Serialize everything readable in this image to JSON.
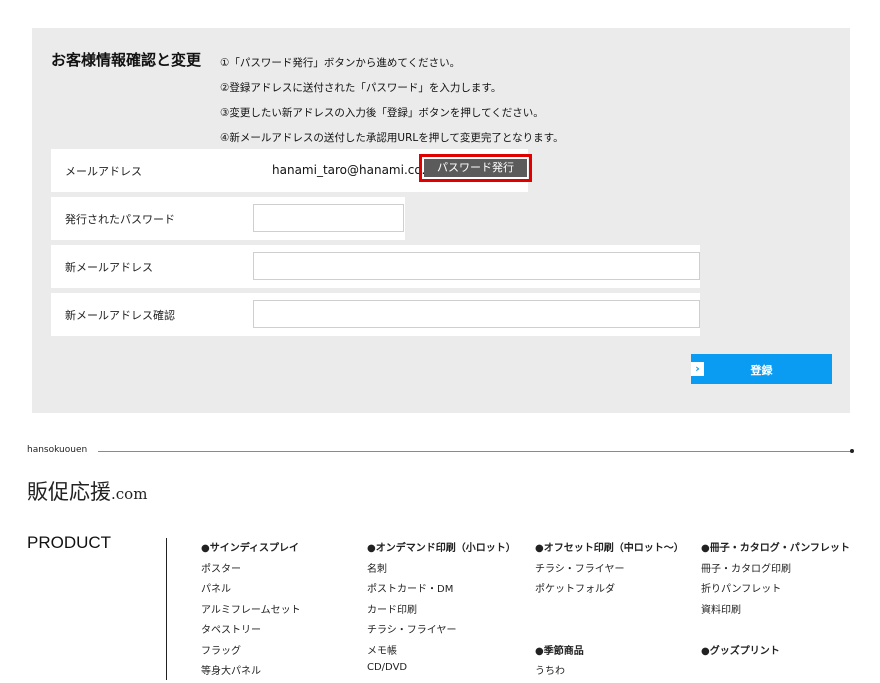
{
  "form": {
    "title": "お客様情報確認と変更",
    "instructions": [
      "①「パスワード発行」ボタンから進めてください。",
      "②登録アドレスに送付された「パスワード」を入力します。",
      "③変更したい新アドレスの入力後「登録」ボタンを押してください。",
      "④新メールアドレスの送付した承認用URLを押して変更完了となります。"
    ],
    "email_label": "メールアドレス",
    "email_value": "hanami_taro@hanami.co.jp",
    "issue_password_button": "パスワード発行",
    "issued_password_label": "発行されたパスワード",
    "issued_password_value": "",
    "new_email_label": "新メールアドレス",
    "new_email_value": "",
    "new_email_confirm_label": "新メールアドレス確認",
    "new_email_confirm_value": "",
    "submit_button": "登録",
    "highlight_color": "#e00000",
    "submit_color": "#0a9bf2"
  },
  "footer": {
    "brand_line_label": "hansokuouen",
    "logo_main": "販促応援",
    "logo_suffix": ".com",
    "product_heading": "PRODUCT",
    "columns": [
      {
        "category": "●サインディスプレイ",
        "items": [
          "ポスター",
          "パネル",
          "アルミフレームセット",
          "タペストリー",
          "フラッグ",
          "等身大パネル"
        ]
      },
      {
        "category": "●オンデマンド印刷（小ロット）",
        "items": [
          "名刺",
          "ポストカード・DM",
          "カード印刷",
          "チラシ・フライヤー",
          "メモ帳",
          "CD/DVD"
        ]
      },
      {
        "category": "●オフセット印刷（中ロット〜）",
        "items": [
          "チラシ・フライヤー",
          "ポケットフォルダ"
        ],
        "category2": "●季節商品",
        "items2": [
          "うちわ"
        ]
      },
      {
        "category": "●冊子・カタログ・パンフレット",
        "items": [
          "冊子・カタログ印刷",
          "折りパンフレット",
          "資料印刷"
        ],
        "category2": "●グッズプリント"
      }
    ]
  }
}
